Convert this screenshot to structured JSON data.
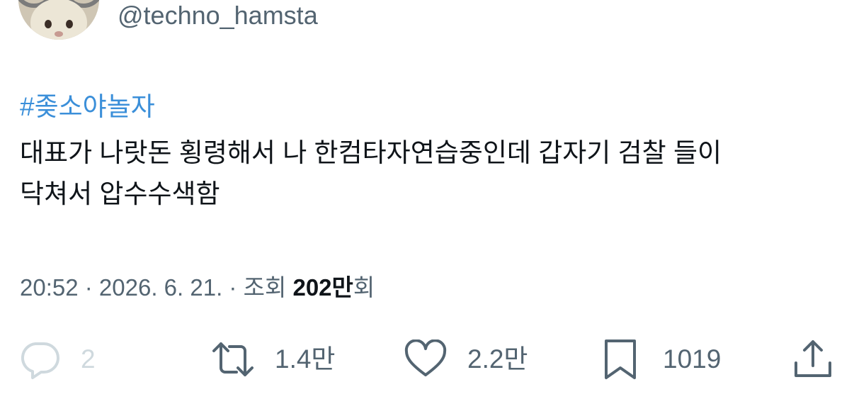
{
  "author": {
    "handle": "@techno_hamsta"
  },
  "tweet": {
    "hashtag": "#좆소야놀자",
    "text": "대표가 나랏돈 횡령해서 나 한컴타자연습중인데 갑자기 검찰 들이\n닥쳐서 압수수색함"
  },
  "meta": {
    "time": "20:52",
    "sep1": " · ",
    "date": "2026. 6. 21.",
    "sep2": " · ",
    "views_prefix": "조회 ",
    "views_count": "202만",
    "views_suffix": "회"
  },
  "actions": {
    "reply": {
      "icon": "reply-icon",
      "count": "2"
    },
    "retweet": {
      "icon": "retweet-icon",
      "count": "1.4만"
    },
    "like": {
      "icon": "heart-icon",
      "count": "2.2만"
    },
    "bookmark": {
      "icon": "bookmark-icon",
      "count": "1019"
    },
    "share": {
      "icon": "share-icon"
    }
  },
  "colors": {
    "link": "#3b8fd9",
    "secondary": "#536471",
    "primary_text": "#0f1419",
    "disabled": "#cfd9de"
  }
}
